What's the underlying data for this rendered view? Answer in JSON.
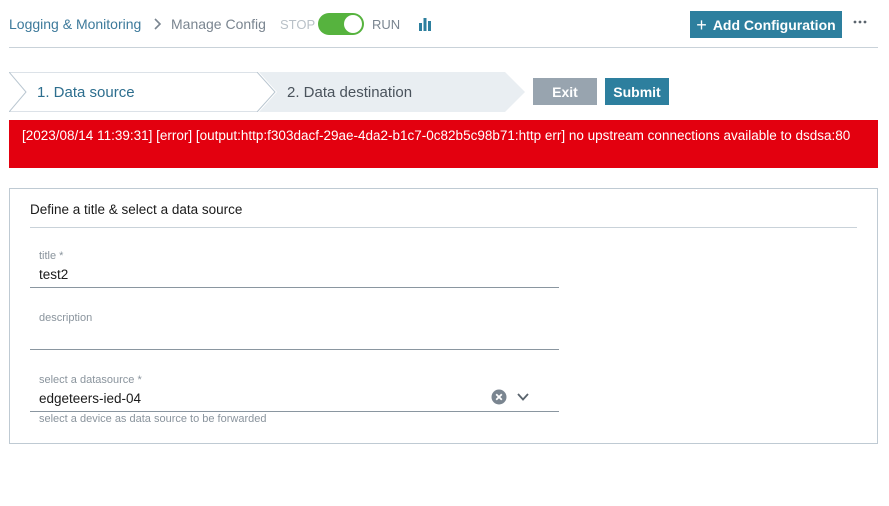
{
  "header": {
    "breadcrumb_root": "Logging & Monitoring",
    "breadcrumb_current": "Manage Config",
    "stop_label": "STOP",
    "run_label": "RUN",
    "toggle_state": "run",
    "add_button_label": "Add Configuration",
    "add_button_icon": "plus-icon",
    "more_icon": "more-horizontal-icon",
    "chart_icon": "bar-chart-icon"
  },
  "wizard": {
    "steps": [
      {
        "label": "1. Data source",
        "active": true
      },
      {
        "label": "2. Data destination",
        "active": false
      }
    ],
    "exit_label": "Exit",
    "submit_label": "Submit"
  },
  "error": {
    "message": "[2023/08/14 11:39:31] [error] [output:http:f303dacf-29ae-4da2-b1c7-0c82b5c98b71:http err] no upstream connections available to dsdsa:80"
  },
  "form": {
    "section_title": "Define a title & select a data source",
    "title_field": {
      "label": "title *",
      "value": "test2"
    },
    "description_field": {
      "label": "description",
      "value": ""
    },
    "datasource_field": {
      "label": "select a datasource *",
      "value": "edgeteers-ied-04",
      "hint": "select a device as data source to be forwarded"
    }
  },
  "colors": {
    "accent": "#2d7f9e",
    "error_bg": "#e3000f",
    "toggle_on": "#56b33e",
    "disabled_button": "#98a4af",
    "link": "#3d7a9b"
  }
}
